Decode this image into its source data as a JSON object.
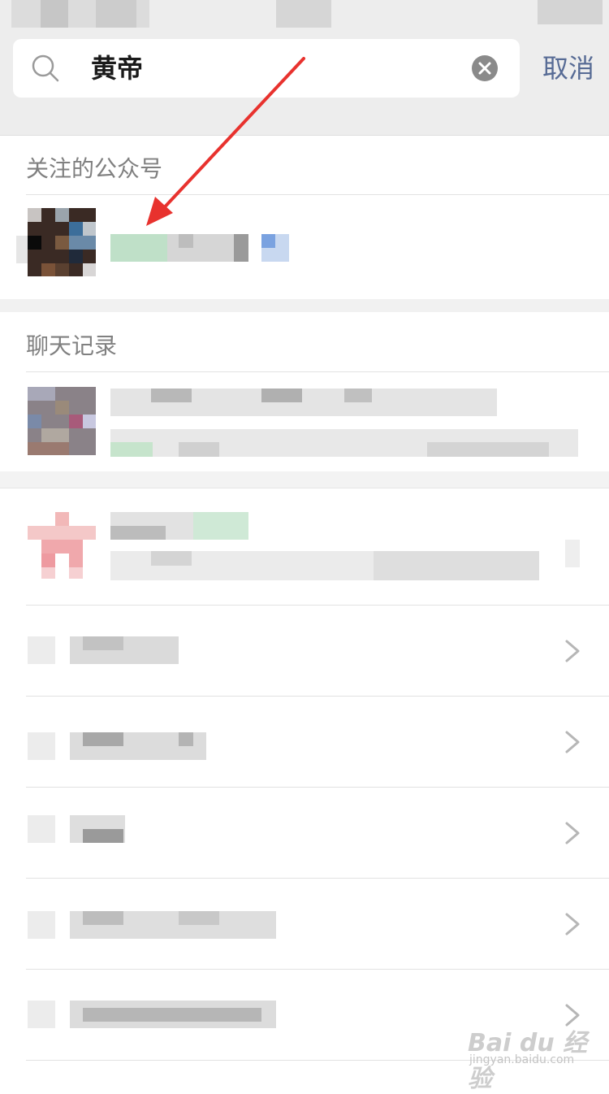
{
  "search": {
    "query": "黄帝",
    "cancel_label": "取消"
  },
  "sections": {
    "followed_accounts_title": "关注的公众号",
    "chat_records_title": "聊天记录"
  },
  "watermark": {
    "brand": "Bai du 经验",
    "url": "jingyan.baidu.com"
  },
  "icons": {
    "search": "search-icon",
    "clear": "clear-icon",
    "chevron": "chevron-right-icon"
  },
  "colors": {
    "accent_link": "#576b95",
    "annotation_arrow": "#e8322e",
    "background_gray": "#ededed"
  }
}
